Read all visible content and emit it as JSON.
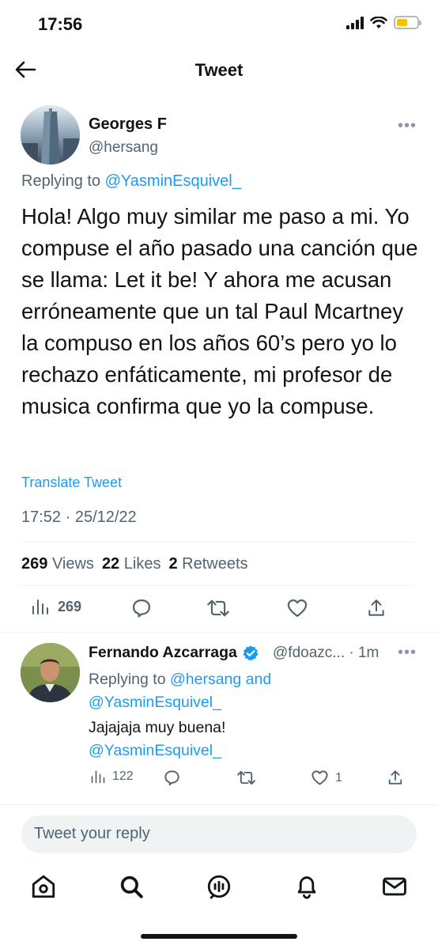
{
  "status_bar": {
    "time": "17:56"
  },
  "header": {
    "title": "Tweet"
  },
  "tweet": {
    "author_name": "Georges F",
    "author_handle": "@hersang",
    "replying_prefix": "Replying to",
    "replying_to": "@YasminEsquivel_",
    "text": "Hola! Algo muy similar me paso a mi. Yo compuse el año pasado una canción que se llama: Let it be! Y ahora me acusan erróneamente que un tal Paul Mcartney la compuso en los años 60’s pero yo lo rechazo enfáticamente, mi profesor de musica confirma que yo la compuse.",
    "translate_label": "Translate Tweet",
    "timestamp": "17:52 · 25/12/22",
    "stats": {
      "views_count": "269",
      "views_label": "Views",
      "likes_count": "22",
      "likes_label": "Likes",
      "retweets_count": "2",
      "retweets_label": "Retweets"
    },
    "actions": {
      "views_count": "269"
    }
  },
  "reply": {
    "author_name": "Fernando Azcarraga",
    "author_handle": "@fdoazc... · 1m",
    "replying_prefix": "Replying to",
    "replying_to_1": "@hersang",
    "replying_and": "and",
    "replying_to_2": "@YasminEsquivel_",
    "text": "Jajajaja muy buena!",
    "mention": "@YasminEsquivel_",
    "views_count": "122",
    "likes_count": "1"
  },
  "compose": {
    "placeholder": "Tweet your reply"
  },
  "colors": {
    "accent": "#1d9bf0",
    "verified": "#1d9bf0",
    "secondary_text": "#536471"
  },
  "icons": [
    "back-arrow-icon",
    "more-icon",
    "views-icon",
    "reply-icon",
    "retweet-icon",
    "like-icon",
    "share-icon",
    "verified-icon",
    "home-icon",
    "search-icon",
    "spaces-icon",
    "notifications-icon",
    "messages-icon"
  ]
}
